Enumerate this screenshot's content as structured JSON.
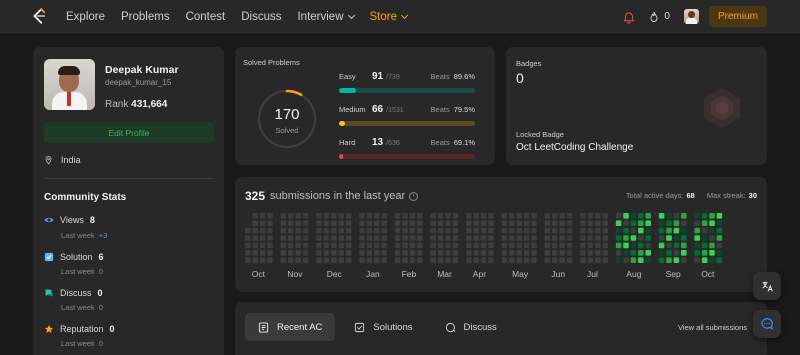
{
  "nav": {
    "links": [
      "Explore",
      "Problems",
      "Contest",
      "Discuss",
      "Interview",
      "Store"
    ],
    "streak": "0",
    "premium": "Premium"
  },
  "profile": {
    "name": "Deepak Kumar",
    "username": "deepak_kumar_15",
    "rank_label": "Rank",
    "rank": "431,664",
    "edit": "Edit Profile",
    "location": "India"
  },
  "community": {
    "title": "Community Stats",
    "last_week": "Last week",
    "stats": [
      {
        "label": "Views",
        "value": "8",
        "delta": "+3",
        "icon": "eye-icon",
        "color": "#5c8df6"
      },
      {
        "label": "Solution",
        "value": "6",
        "delta": "0",
        "icon": "check-square-icon",
        "color": "#5cb7f6"
      },
      {
        "label": "Discuss",
        "value": "0",
        "delta": "0",
        "icon": "discuss-icon",
        "color": "#2cc5a8"
      },
      {
        "label": "Reputation",
        "value": "0",
        "delta": "0",
        "icon": "star-icon",
        "color": "#ffa116"
      }
    ]
  },
  "solved": {
    "title": "Solved Problems",
    "total": "170",
    "total_label": "Solved",
    "beats_label": "Beats",
    "difficulties": [
      {
        "name": "Easy",
        "count": "91",
        "total": "/739",
        "beats": "89.6%",
        "fraction": 0.123,
        "color": "#00b8a3",
        "track": "#1e4a46"
      },
      {
        "name": "Medium",
        "count": "66",
        "total": "/1531",
        "beats": "79.5%",
        "fraction": 0.043,
        "color": "#ffc01e",
        "track": "#5a4a1e"
      },
      {
        "name": "Hard",
        "count": "13",
        "total": "/636",
        "beats": "69.1%",
        "fraction": 0.02,
        "color": "#ef4743",
        "track": "#5a2626"
      }
    ]
  },
  "badges": {
    "label": "Badges",
    "count": "0",
    "locked_label": "Locked Badge",
    "locked_name": "Oct LeetCoding Challenge"
  },
  "submissions": {
    "count": "325",
    "text": "submissions in the last year",
    "active_label": "Total active days:",
    "active": "68",
    "streak_label": "Max streak:",
    "streak": "30",
    "months": [
      "Oct",
      "Nov",
      "Dec",
      "Jan",
      "Feb",
      "Mar",
      "Apr",
      "May",
      "Jun",
      "Jul",
      "Aug",
      "Sep",
      "Oct"
    ]
  },
  "recent": {
    "tabs": [
      "Recent AC",
      "Solutions",
      "Discuss"
    ],
    "view_all": "View all submissions"
  }
}
